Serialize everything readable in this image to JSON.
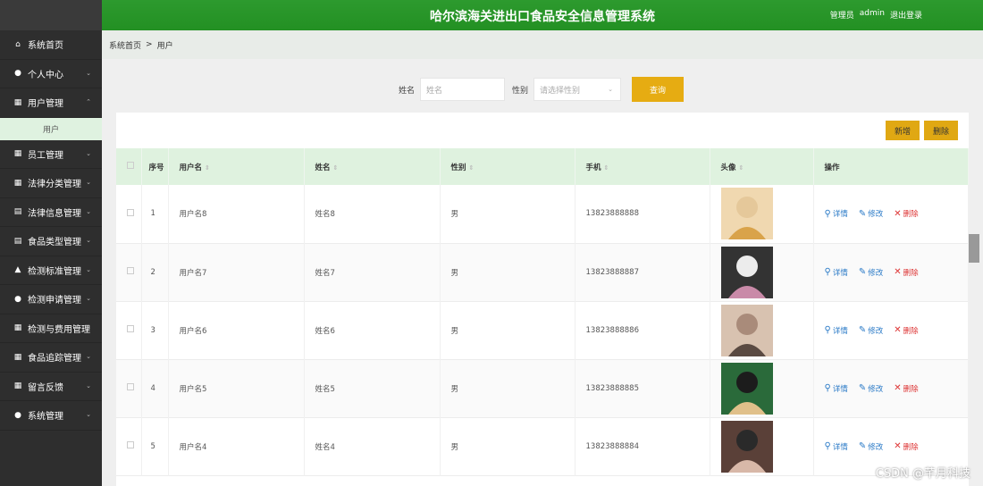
{
  "header": {
    "title": "哈尔滨海关进出口食品安全信息管理系统",
    "role": "管理员",
    "user": "admin",
    "logout": "退出登录"
  },
  "sidebar": {
    "items": [
      {
        "label": "系统首页",
        "icon": "home-icon",
        "glyph": "⌂",
        "chev": ""
      },
      {
        "label": "个人中心",
        "icon": "user-icon",
        "glyph": "●",
        "chev": "⌄"
      },
      {
        "label": "用户管理",
        "icon": "grid-icon",
        "glyph": "▦",
        "chev": "⌃"
      },
      {
        "label": "员工管理",
        "icon": "grid-icon",
        "glyph": "▦",
        "chev": "⌄"
      },
      {
        "label": "法律分类管理",
        "icon": "grid-icon",
        "glyph": "▦",
        "chev": "⌄"
      },
      {
        "label": "法律信息管理",
        "icon": "clipboard-icon",
        "glyph": "▤",
        "chev": "⌄"
      },
      {
        "label": "食品类型管理",
        "icon": "doc-icon",
        "glyph": "▤",
        "chev": "⌄"
      },
      {
        "label": "检测标准管理",
        "icon": "bank-icon",
        "glyph": "▲",
        "chev": "⌄"
      },
      {
        "label": "检测申请管理",
        "icon": "bulb-icon",
        "glyph": "●",
        "chev": "⌄"
      },
      {
        "label": "检测与费用管理",
        "icon": "grid-icon",
        "glyph": "▦",
        "chev": "⌄"
      },
      {
        "label": "食品追踪管理",
        "icon": "grid-icon",
        "glyph": "▦",
        "chev": "⌄"
      },
      {
        "label": "留言反馈",
        "icon": "grid-icon",
        "glyph": "▦",
        "chev": "⌄"
      },
      {
        "label": "系统管理",
        "icon": "user-icon",
        "glyph": "●",
        "chev": "⌄"
      }
    ],
    "sub_item": "用户"
  },
  "breadcrumb": {
    "home": "系统首页",
    "sep": ">",
    "current": "用户"
  },
  "search": {
    "name_label": "姓名",
    "name_placeholder": "姓名",
    "gender_label": "性别",
    "gender_placeholder": "请选择性别",
    "query": "查询"
  },
  "actions": {
    "add": "新增",
    "delete": "删除"
  },
  "table": {
    "headers": {
      "index": "序号",
      "username": "用户名",
      "name": "姓名",
      "gender": "性别",
      "phone": "手机",
      "avatar": "头像",
      "ops": "操作"
    },
    "ops": {
      "detail": "详情",
      "edit": "修改",
      "delete": "删除"
    },
    "rows": [
      {
        "index": "1",
        "username": "用户名8",
        "name": "姓名8",
        "gender": "男",
        "phone": "13823888888"
      },
      {
        "index": "2",
        "username": "用户名7",
        "name": "姓名7",
        "gender": "男",
        "phone": "13823888887"
      },
      {
        "index": "3",
        "username": "用户名6",
        "name": "姓名6",
        "gender": "男",
        "phone": "13823888886"
      },
      {
        "index": "4",
        "username": "用户名5",
        "name": "姓名5",
        "gender": "男",
        "phone": "13823888885"
      },
      {
        "index": "5",
        "username": "用户名4",
        "name": "姓名4",
        "gender": "男",
        "phone": "13823888884"
      }
    ]
  },
  "watermark": "CSDN @芊月科技",
  "colors": {
    "header": "#2d9a2e",
    "sidebar": "#2e2e2e",
    "accent": "#e6ac12",
    "table_head": "#dff2df"
  }
}
